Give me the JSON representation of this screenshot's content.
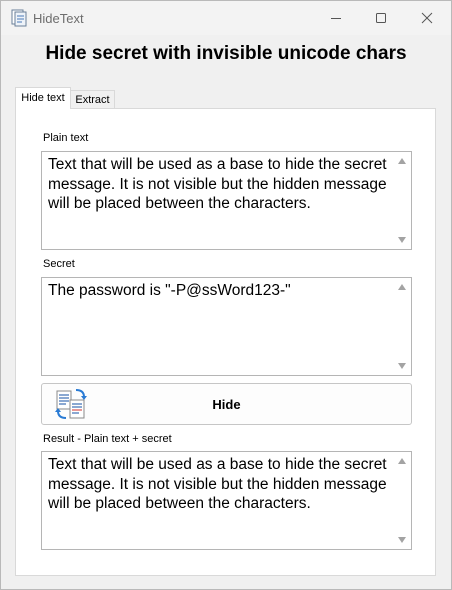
{
  "window": {
    "title": "HideText"
  },
  "heading": "Hide secret with invisible unicode chars",
  "tabs": [
    {
      "label": "Hide text",
      "active": true
    },
    {
      "label": "Extract",
      "active": false
    }
  ],
  "plain_text": {
    "label": "Plain text",
    "value": "Text that will be used as a base to hide the secret message. It is not visible but the hidden message will be placed between the characters."
  },
  "secret": {
    "label": "Secret",
    "value": "The password is \"-P@ssWord123-\""
  },
  "hide_button": {
    "label": "Hide",
    "icon": "hide-document-icon"
  },
  "result": {
    "label": "Result - Plain text + secret",
    "value": "Text that will be used as a base to hide the secret message. It is not visible but the hidden message will be placed between the characters."
  }
}
